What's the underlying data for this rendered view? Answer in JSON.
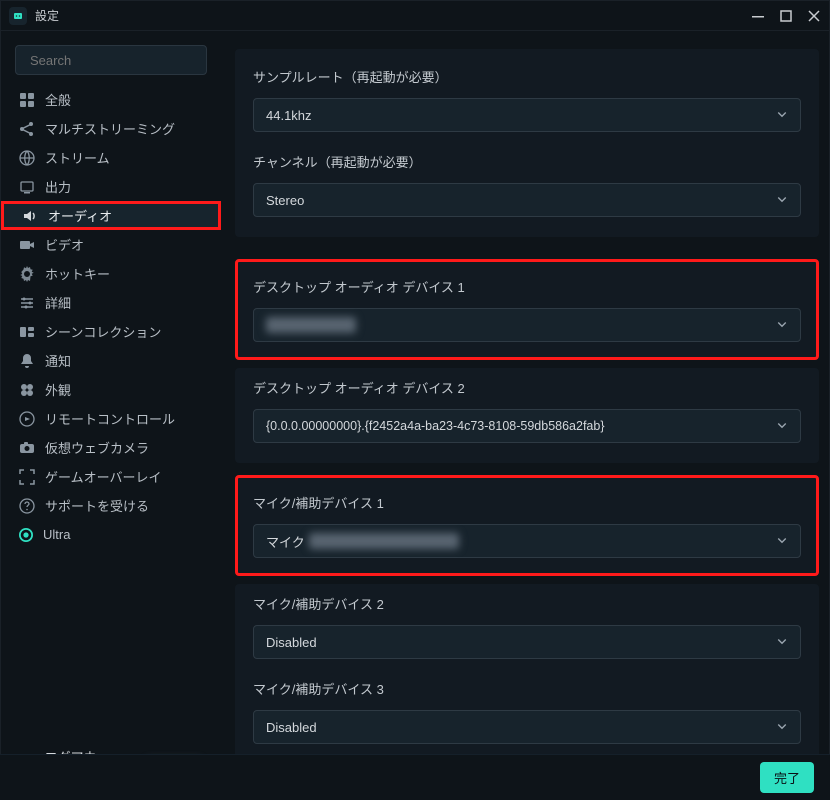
{
  "window": {
    "title": "設定"
  },
  "search": {
    "placeholder": "Search"
  },
  "sidebar": {
    "items": [
      {
        "label": "全般"
      },
      {
        "label": "マルチストリーミング"
      },
      {
        "label": "ストリーム"
      },
      {
        "label": "出力"
      },
      {
        "label": "オーディオ"
      },
      {
        "label": "ビデオ"
      },
      {
        "label": "ホットキー"
      },
      {
        "label": "詳細"
      },
      {
        "label": "シーンコレクション"
      },
      {
        "label": "通知"
      },
      {
        "label": "外観"
      },
      {
        "label": "リモートコントロール"
      },
      {
        "label": "仮想ウェブカメラ"
      },
      {
        "label": "ゲームオーバーレイ"
      },
      {
        "label": "サポートを受ける"
      },
      {
        "label": "Ultra"
      }
    ],
    "logout": "ログアウト"
  },
  "audio": {
    "sample_rate_label": "サンプルレート（再起動が必要）",
    "sample_rate_value": "44.1khz",
    "channels_label": "チャンネル（再起動が必要）",
    "channels_value": "Stereo",
    "desktop1_label": "デスクトップ オーディオ デバイス 1",
    "desktop1_value": "",
    "desktop2_label": "デスクトップ オーディオ デバイス 2",
    "desktop2_value": "{0.0.0.00000000}.{f2452a4a-ba23-4c73-8108-59db586a2fab}",
    "mic1_label": "マイク/補助デバイス 1",
    "mic1_prefix": "マイク",
    "mic2_label": "マイク/補助デバイス 2",
    "mic2_value": "Disabled",
    "mic3_label": "マイク/補助デバイス 3",
    "mic3_value": "Disabled"
  },
  "footer": {
    "done": "完了"
  }
}
